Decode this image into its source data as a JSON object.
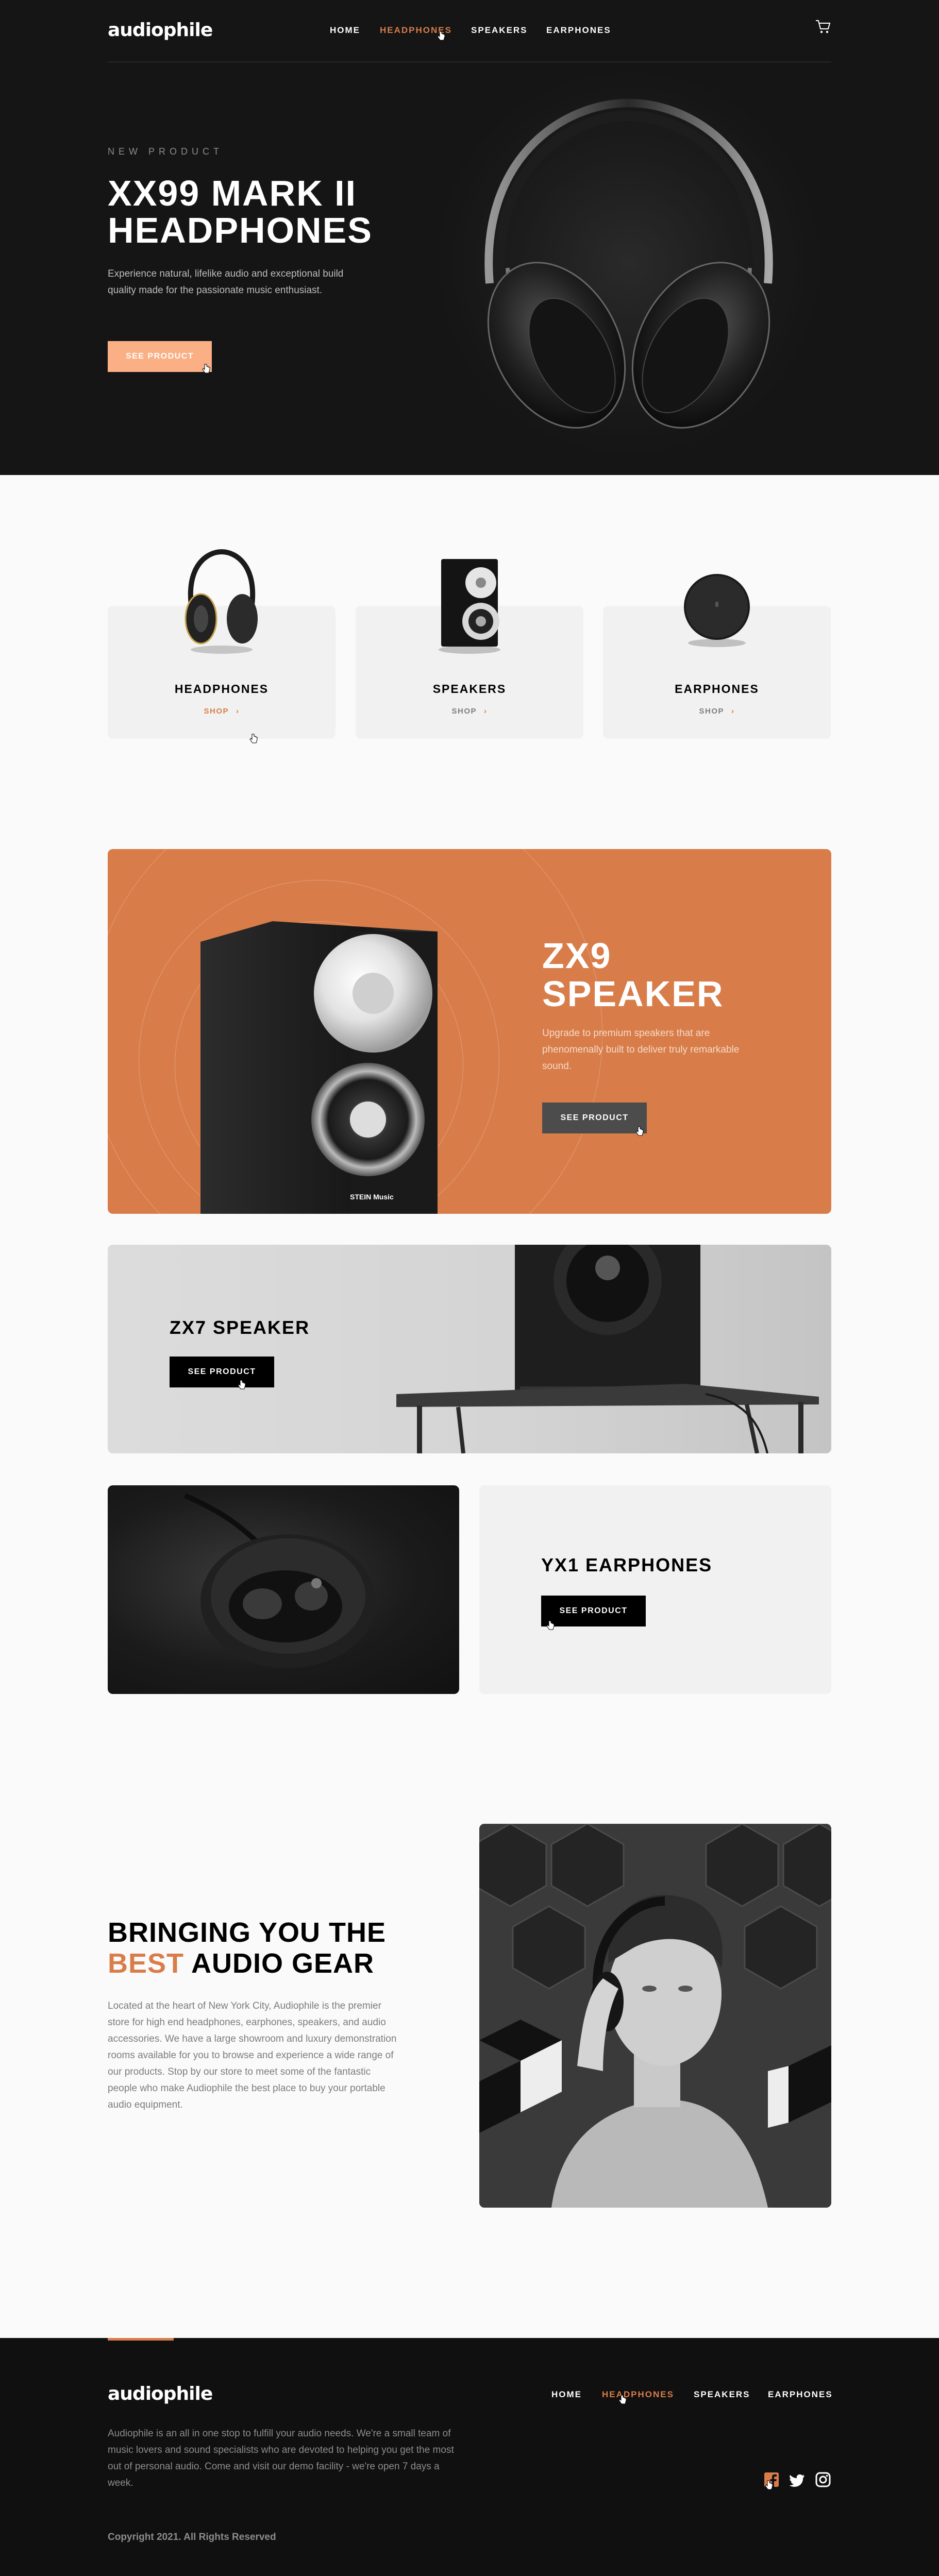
{
  "brand": {
    "logo": "audiophile",
    "accent": "#D87D4A",
    "accent_light": "#FBAF85",
    "dark": "#101010"
  },
  "nav": {
    "items": [
      {
        "label": "HOME",
        "active": false
      },
      {
        "label": "HEADPHONES",
        "active": true
      },
      {
        "label": "SPEAKERS",
        "active": false
      },
      {
        "label": "EARPHONES",
        "active": false
      }
    ],
    "cart_icon": "cart-icon"
  },
  "hero": {
    "overline": "NEW PRODUCT",
    "title_line1": "XX99 MARK II",
    "title_line2": "HEADPHONES",
    "description": "Experience natural, lifelike audio and exceptional build quality made for the passionate music enthusiast.",
    "button": "SEE PRODUCT"
  },
  "categories": [
    {
      "title": "HEADPHONES",
      "shop": "SHOP"
    },
    {
      "title": "SPEAKERS",
      "shop": "SHOP"
    },
    {
      "title": "EARPHONES",
      "shop": "SHOP"
    }
  ],
  "zx9": {
    "title_line1": "ZX9",
    "title_line2": "SPEAKER",
    "description": "Upgrade to premium speakers that are phenomenally built to deliver truly remarkable sound.",
    "button": "SEE PRODUCT",
    "brand_mark": "STEIN Music"
  },
  "zx7": {
    "title": "ZX7 SPEAKER",
    "button": "SEE PRODUCT"
  },
  "yx1": {
    "title": "YX1 EARPHONES",
    "button": "SEE PRODUCT"
  },
  "about": {
    "title_line1": "BRINGING YOU THE",
    "title_accent": "BEST",
    "title_rest": " AUDIO GEAR",
    "description": "Located at the heart of New York City, Audiophile is the premier store for high end headphones, earphones, speakers, and audio accessories. We have a large showroom and luxury demonstration rooms available for you to browse and experience a wide range of our products. Stop by our store to meet some of the fantastic people who make Audiophile the best place to buy your portable audio equipment."
  },
  "footer": {
    "logo": "audiophile",
    "nav": [
      {
        "label": "HOME",
        "active": false
      },
      {
        "label": "HEADPHONES",
        "active": true
      },
      {
        "label": "SPEAKERS",
        "active": false
      },
      {
        "label": "EARPHONES",
        "active": false
      }
    ],
    "description": "Audiophile is an all in one stop to fulfill your audio needs. We're a small team of music lovers and sound specialists who are devoted to helping you get the most out of personal audio. Come and visit our demo facility - we're open 7 days a week.",
    "copyright": "Copyright 2021. All Rights Reserved",
    "social": [
      "facebook-icon",
      "twitter-icon",
      "instagram-icon"
    ]
  }
}
